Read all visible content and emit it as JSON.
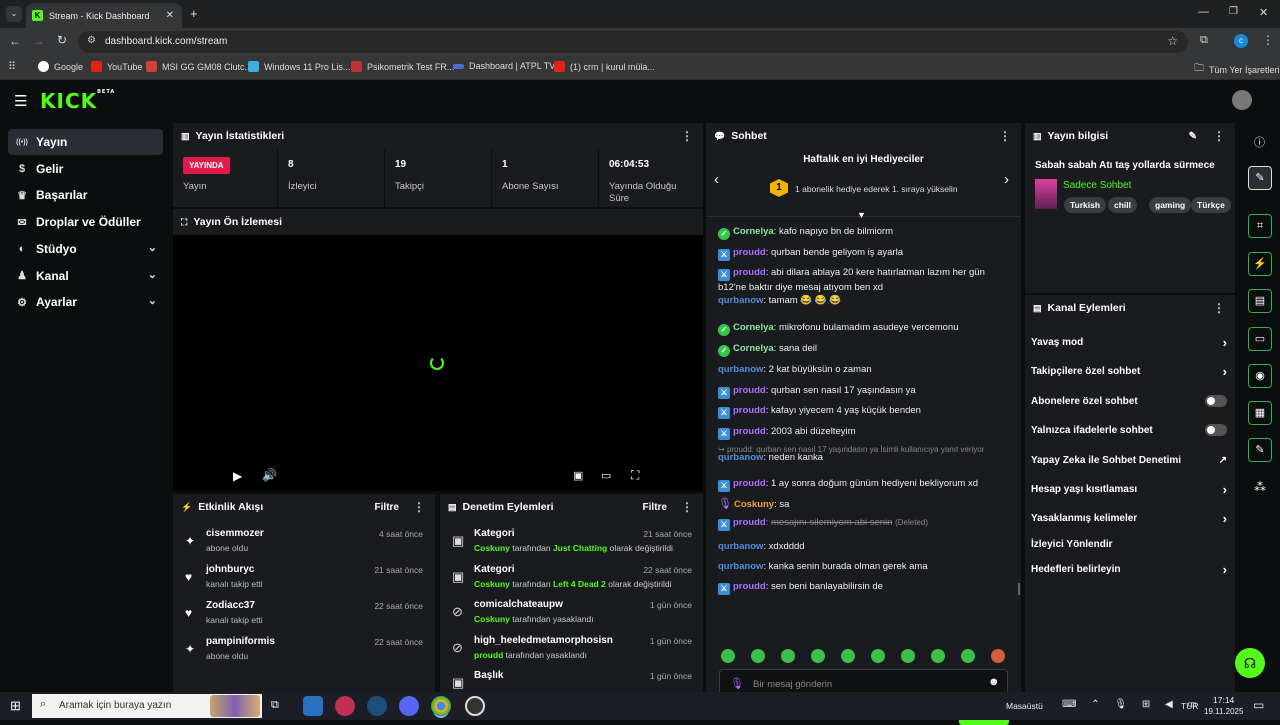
{
  "browser": {
    "tab_title": "Stream - Kick Dashboard",
    "url": "dashboard.kick.com/stream",
    "bookmarks": [
      "Google",
      "YouTube",
      "MSI GG GM08 Clutc...",
      "Windows 11 Pro Lis...",
      "Psikometrik Test FR...",
      "Dashboard | ATPL TV",
      "(1) crm | kurul müla..."
    ],
    "all_bookmarks": "Tüm Yer İşaretleri",
    "profile_initial": "c"
  },
  "app": {
    "logo": "KICK",
    "logo_sup": "BETA",
    "nav": [
      {
        "label": "Yayın",
        "icon": "broadcast-icon",
        "active": true,
        "chevron": false
      },
      {
        "label": "Gelir",
        "icon": "dollar-icon",
        "chevron": false
      },
      {
        "label": "Başarılar",
        "icon": "trophy-icon",
        "chevron": false
      },
      {
        "label": "Droplar ve Ödüller",
        "icon": "gift-icon",
        "chevron": false
      },
      {
        "label": "Stüdyo",
        "icon": "palette-icon",
        "chevron": true
      },
      {
        "label": "Kanal",
        "icon": "person-icon",
        "chevron": true
      },
      {
        "label": "Ayarlar",
        "icon": "gear-icon",
        "chevron": true
      }
    ]
  },
  "stats": {
    "title": "Yayın İstatistikleri",
    "live_badge": "YAYINDA",
    "live_label": "Yayın",
    "items": [
      {
        "value": "8",
        "label": "İzleyici"
      },
      {
        "value": "19",
        "label": "Takipçi"
      },
      {
        "value": "1",
        "label": "Abone Sayısı"
      },
      {
        "value": "06:04:53",
        "label": "Yayında Olduğu Süre"
      }
    ]
  },
  "preview": {
    "title": "Yayın Ön İzlemesi"
  },
  "activity": {
    "title": "Etkinlik Akışı",
    "filter": "Filtre",
    "items": [
      {
        "name": "cisemmozer",
        "sub": "abone oldu",
        "time": "4 saat önce",
        "icon": "sparkle-icon"
      },
      {
        "name": "johnburyc",
        "sub": "kanalı takip etti",
        "time": "21 saat önce",
        "icon": "heart-icon"
      },
      {
        "name": "Zodiacc37",
        "sub": "kanalı takip etti",
        "time": "22 saat önce",
        "icon": "heart-icon"
      },
      {
        "name": "pampiniformis",
        "sub": "abone oldu",
        "time": "22 saat önce",
        "icon": "sparkle-icon"
      }
    ]
  },
  "moderation": {
    "title": "Denetim Eylemleri",
    "filter": "Filtre",
    "items": [
      {
        "title": "Kategori",
        "user": "Coskuny",
        "mid": "tarafından",
        "value": "Just Chatting",
        "end": "olarak değiştirildi",
        "time": "21 saat önce",
        "icon": "category-icon"
      },
      {
        "title": "Kategori",
        "user": "Coskuny",
        "mid": "tarafından",
        "value": "Left 4 Dead 2",
        "end": "olarak değiştirildi",
        "time": "22 saat önce",
        "icon": "category-icon"
      },
      {
        "title": "comicalchateaupw",
        "user": "Coskuny",
        "mid": "tarafından yasaklandı",
        "value": "",
        "end": "",
        "time": "1 gün önce",
        "icon": "ban-icon"
      },
      {
        "title": "high_heeledmetamorphosisn",
        "user": "proudd",
        "mid": "tarafından yasaklandı",
        "value": "",
        "end": "",
        "time": "1 gün önce",
        "icon": "ban-icon"
      },
      {
        "title": "Başlık",
        "user": "",
        "mid": "",
        "value": "",
        "end": "",
        "time": "1 gün önce",
        "icon": "category-icon"
      }
    ]
  },
  "chat": {
    "title": "Sohbet",
    "gifters_title": "Haftalık en iyi Hediyeciler",
    "gifters_rank": "1",
    "gifters_text": "1 abonelik hediye ederek 1. sıraya yükselin",
    "reply_line": "proudd: qurban sen nasıl 17 yaşındasın ya İsimli kullanıcıya yanıt veriyor",
    "deleted_user": "proudd",
    "deleted_text": "mesajını silemiyom abi senin",
    "deleted_tag": "(Deleted)",
    "messages": [
      {
        "user": "Cornelya",
        "badge": "green",
        "color": "green",
        "text": "kafo napıyo bn de bilmiorm"
      },
      {
        "user": "proudd",
        "badge": "blue",
        "color": "purple",
        "text": "qurban bende geliyom iş ayarla"
      },
      {
        "user": "proudd",
        "badge": "blue",
        "color": "purple",
        "text": "abi dilara ablaya 20 kere hatırlatman lazım her gün b12'ne baktır diye mesaj atıyom ben xd"
      },
      {
        "user": "qurbanow",
        "badge": "",
        "color": "blue",
        "text": "tamam 😂 😂 😂"
      },
      {
        "user": "Cornelya",
        "badge": "green",
        "color": "green",
        "text": "mikrofonu bulamadım asudeye vercemonu"
      },
      {
        "user": "Cornelya",
        "badge": "green",
        "color": "green",
        "text": "sana deil"
      },
      {
        "user": "qurbanow",
        "badge": "",
        "color": "blue",
        "text": "2 kat büyüksün o zaman"
      },
      {
        "user": "proudd",
        "badge": "blue",
        "color": "purple",
        "text": "qurban sen nasıl 17 yaşındasın ya"
      },
      {
        "user": "proudd",
        "badge": "blue",
        "color": "purple",
        "text": "kafayı yiyecem 4 yaş küçük benden"
      },
      {
        "user": "proudd",
        "badge": "blue",
        "color": "purple",
        "text": "2003 abi düzelteyim"
      },
      {
        "user": "qurbanow",
        "badge": "",
        "color": "blue",
        "text": "neden kanka"
      },
      {
        "user": "proudd",
        "badge": "blue",
        "color": "purple",
        "text": "1 ay sonra doğum günüm hediyeni bekliyorum xd"
      },
      {
        "user": "Coskuny",
        "badge": "mic",
        "color": "orange",
        "text": "sa"
      },
      {
        "user": "qurbanow",
        "badge": "",
        "color": "blue",
        "text": "xdxdddd"
      },
      {
        "user": "qurbanow",
        "badge": "",
        "color": "blue",
        "text": "kanka senin burada olman gerek ama"
      },
      {
        "user": "proudd",
        "badge": "blue",
        "color": "purple",
        "text": "sen beni banlayabilirsin de"
      }
    ],
    "input_placeholder": "Bir mesaj gönderin",
    "send_label": "Gönder"
  },
  "stream_info": {
    "title": "Yayın bilgisi",
    "stream_title": "Sabah sabah Atı taş yollarda sürmece",
    "category": "Sadece Sohbet",
    "tags": [
      "Turkish",
      "chill",
      "gaming",
      "Türkçe"
    ]
  },
  "channel_actions": {
    "title": "Kanal Eylemleri",
    "items": [
      {
        "label": "Yavaş mod",
        "control": "arrow"
      },
      {
        "label": "Takipçilere özel sohbet",
        "control": "arrow"
      },
      {
        "label": "Abonelere özel sohbet",
        "control": "toggle"
      },
      {
        "label": "Yalnızca ifadelerle sohbet",
        "control": "toggle"
      },
      {
        "label": "Yapay Zeka ile Sohbet Denetimi",
        "control": "external"
      },
      {
        "label": "Hesap yaşı kısıtlaması",
        "control": "arrow"
      },
      {
        "label": "Yasaklanmış kelimeler",
        "control": "arrow"
      },
      {
        "label": "İzleyici Yönlendir",
        "control": "none"
      },
      {
        "label": "Hedefleri belirleyin",
        "control": "arrow"
      }
    ]
  },
  "taskbar": {
    "search_placeholder": "Aramak için buraya yazın",
    "desktop": "Masaüstü",
    "lang": "TUR",
    "time": "17:14",
    "date": "19.11.2025"
  },
  "colors": {
    "accent": "#53fc18",
    "panel": "#191b1f",
    "bg": "#0b0e0f",
    "live": "#e01b4c"
  }
}
